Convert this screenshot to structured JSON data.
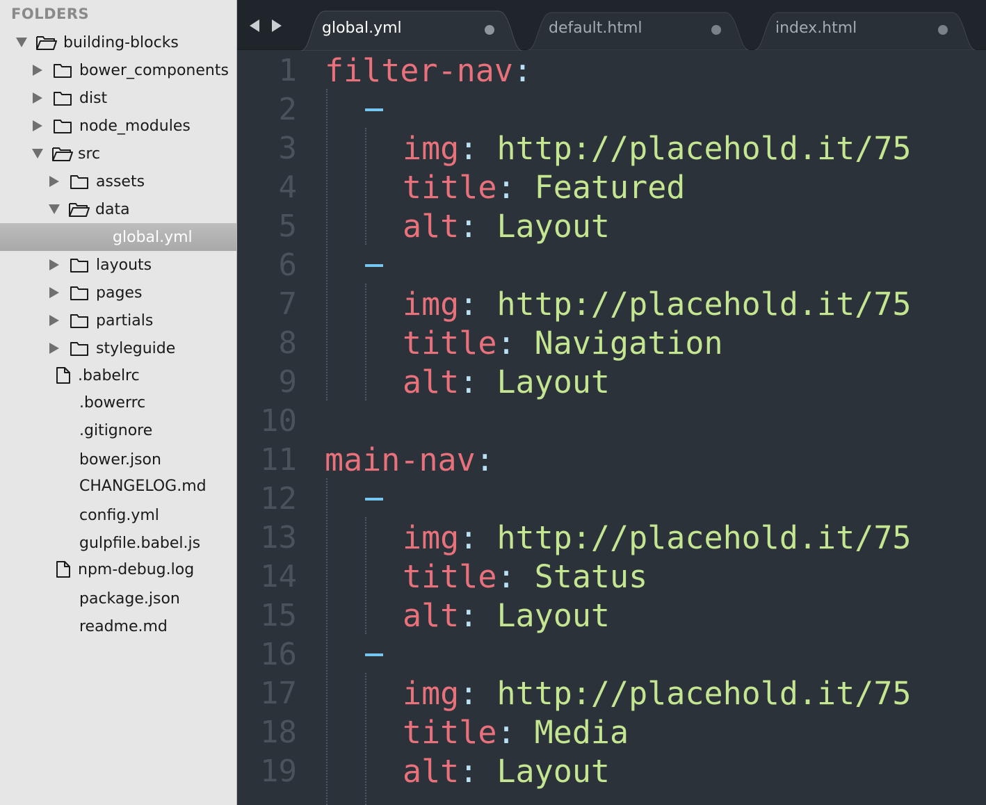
{
  "sidebar": {
    "header": "FOLDERS",
    "items": [
      {
        "label": "building-blocks",
        "kind": "folder",
        "expanded": true,
        "depth": 0
      },
      {
        "label": "bower_components",
        "kind": "folder",
        "expanded": false,
        "depth": 1
      },
      {
        "label": "dist",
        "kind": "folder",
        "expanded": false,
        "depth": 1
      },
      {
        "label": "node_modules",
        "kind": "folder",
        "expanded": false,
        "depth": 1
      },
      {
        "label": "src",
        "kind": "folder",
        "expanded": true,
        "depth": 1
      },
      {
        "label": "assets",
        "kind": "folder",
        "expanded": false,
        "depth": 2
      },
      {
        "label": "data",
        "kind": "folder",
        "expanded": true,
        "depth": 2
      },
      {
        "label": "global.yml",
        "kind": "file",
        "selected": true,
        "depth": 3
      },
      {
        "label": "layouts",
        "kind": "folder",
        "expanded": false,
        "depth": 2
      },
      {
        "label": "pages",
        "kind": "folder",
        "expanded": false,
        "depth": 2
      },
      {
        "label": "partials",
        "kind": "folder",
        "expanded": false,
        "depth": 2
      },
      {
        "label": "styleguide",
        "kind": "folder",
        "expanded": false,
        "depth": 2
      },
      {
        "label": ".babelrc",
        "kind": "file",
        "icon": "file-icon",
        "depth": 1
      },
      {
        "label": ".bowerrc",
        "kind": "file",
        "depth": 1
      },
      {
        "label": ".gitignore",
        "kind": "file",
        "depth": 1
      },
      {
        "label": "bower.json",
        "kind": "file",
        "depth": 1
      },
      {
        "label": "CHANGELOG.md",
        "kind": "file",
        "depth": 1
      },
      {
        "label": "config.yml",
        "kind": "file",
        "depth": 1
      },
      {
        "label": "gulpfile.babel.js",
        "kind": "file",
        "depth": 1
      },
      {
        "label": "npm-debug.log",
        "kind": "file",
        "icon": "file-icon",
        "depth": 1
      },
      {
        "label": "package.json",
        "kind": "file",
        "depth": 1
      },
      {
        "label": "readme.md",
        "kind": "file",
        "depth": 1
      }
    ]
  },
  "tabs": [
    {
      "label": "global.yml",
      "active": true
    },
    {
      "label": "default.html",
      "active": false
    },
    {
      "label": "index.html",
      "active": false
    }
  ],
  "line_numbers": [
    "1",
    "2",
    "3",
    "4",
    "5",
    "6",
    "7",
    "8",
    "9",
    "10",
    "11",
    "12",
    "13",
    "14",
    "15",
    "16",
    "17",
    "18",
    "19"
  ],
  "code": {
    "l1_key": "filter-nav",
    "l3_key": "img",
    "l3_val": "http://placehold.it/75",
    "l4_key": "title",
    "l4_val": "Featured",
    "l5_key": "alt",
    "l5_val": "Layout",
    "l7_key": "img",
    "l7_val": "http://placehold.it/75",
    "l8_key": "title",
    "l8_val": "Navigation",
    "l9_key": "alt",
    "l9_val": "Layout",
    "l11_key": "main-nav",
    "l13_key": "img",
    "l13_val": "http://placehold.it/75",
    "l14_key": "title",
    "l14_val": "Status",
    "l15_key": "alt",
    "l15_val": "Layout",
    "l17_key": "img",
    "l17_val": "http://placehold.it/75",
    "l18_key": "title",
    "l18_val": "Media",
    "l19_key": "alt",
    "l19_val": "Layout",
    "colon": ":"
  },
  "colors": {
    "key": "#e8717b",
    "value": "#c5e690",
    "dash": "#75c6f0",
    "editor_bg": "#2b323a",
    "sidebar_bg": "#e6e6e6"
  }
}
